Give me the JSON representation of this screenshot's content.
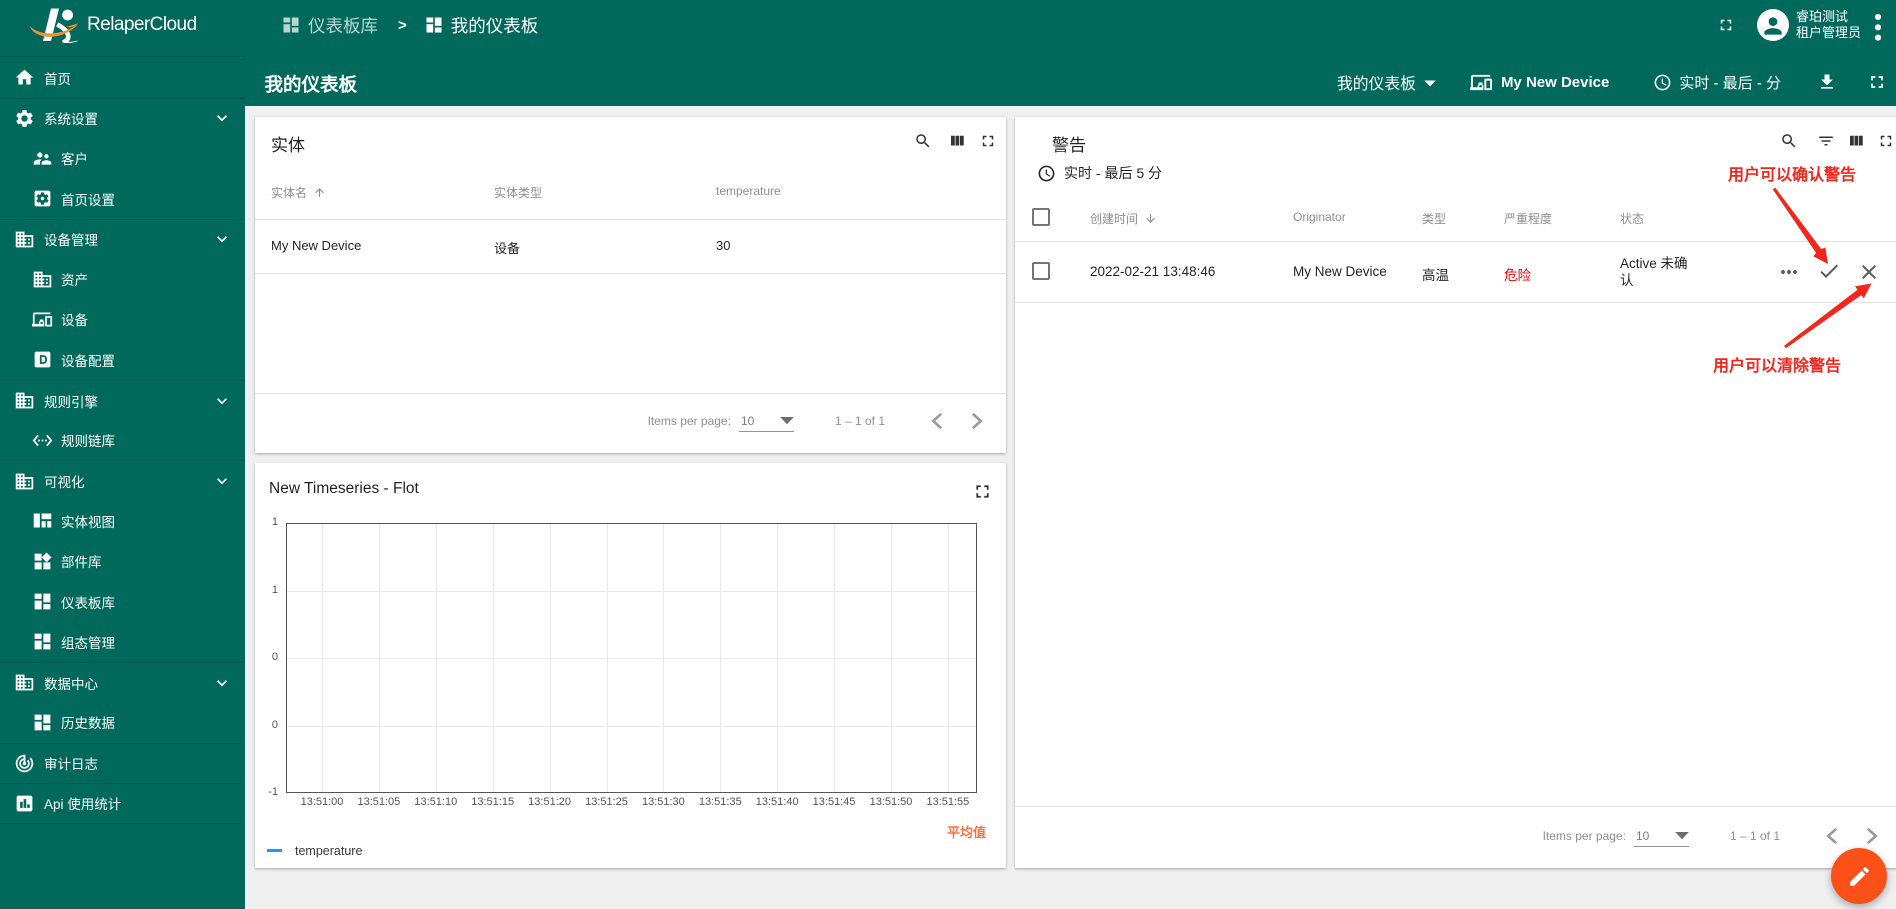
{
  "app": {
    "name": "RelaperCloud"
  },
  "colors": {
    "primary": "#00695c",
    "background": "#efefef",
    "danger_red": "#f00000",
    "annotation_red": "#f3261b",
    "series_blue": "#2196f3",
    "average_label_orange": "#ff7043",
    "fab_orange": "#fb5118",
    "logo_orange": "#ef9434"
  },
  "sidebar": {
    "items": [
      {
        "label": "首页",
        "icon": "home",
        "indent": false,
        "chevron": false,
        "divider": false
      },
      {
        "label": "系统设置",
        "icon": "settings",
        "indent": false,
        "chevron": true,
        "divider": true
      },
      {
        "label": "客户",
        "icon": "supervisor-account",
        "indent": true,
        "chevron": false,
        "divider": false
      },
      {
        "label": "首页设置",
        "icon": "settings-applications",
        "indent": true,
        "chevron": false,
        "divider": false
      },
      {
        "label": "设备管理",
        "icon": "domain",
        "indent": false,
        "chevron": true,
        "divider": true
      },
      {
        "label": "资产",
        "icon": "domain",
        "indent": true,
        "chevron": false,
        "divider": false
      },
      {
        "label": "设备",
        "icon": "devices-other",
        "indent": true,
        "chevron": false,
        "divider": false
      },
      {
        "label": "设备配置",
        "icon": "alpha-d-box",
        "indent": true,
        "chevron": false,
        "divider": false
      },
      {
        "label": "规则引擎",
        "icon": "domain",
        "indent": false,
        "chevron": true,
        "divider": true
      },
      {
        "label": "规则链库",
        "icon": "settings-ethernet",
        "indent": true,
        "chevron": false,
        "divider": false
      },
      {
        "label": "可视化",
        "icon": "domain",
        "indent": false,
        "chevron": true,
        "divider": true
      },
      {
        "label": "实体视图",
        "icon": "view-quilt",
        "indent": true,
        "chevron": false,
        "divider": false
      },
      {
        "label": "部件库",
        "icon": "widgets",
        "indent": true,
        "chevron": false,
        "divider": false
      },
      {
        "label": "仪表板库",
        "icon": "dashboard",
        "indent": true,
        "chevron": false,
        "divider": false
      },
      {
        "label": "组态管理",
        "icon": "dashboard",
        "indent": true,
        "chevron": false,
        "divider": false
      },
      {
        "label": "数据中心",
        "icon": "domain",
        "indent": false,
        "chevron": true,
        "divider": true
      },
      {
        "label": "历史数据",
        "icon": "dashboard",
        "indent": true,
        "chevron": false,
        "divider": false
      },
      {
        "label": "审计日志",
        "icon": "track-changes",
        "indent": false,
        "chevron": false,
        "divider": true
      },
      {
        "label": "Api 使用统计",
        "icon": "insert-chart",
        "indent": false,
        "chevron": false,
        "divider": true
      }
    ]
  },
  "topbar": {
    "breadcrumbs": [
      {
        "label": "仪表板库",
        "icon": "dashboard"
      },
      {
        "label": "我的仪表板",
        "icon": "dashboard"
      }
    ],
    "separator": ">",
    "user": {
      "name": "睿珀测试",
      "role": "租户管理员"
    }
  },
  "toolbar": {
    "title": "我的仪表板",
    "state_select": "我的仪表板",
    "device_label": "My New Device",
    "time_label": "实时 - 最后 - 分"
  },
  "entities_card": {
    "title": "实体",
    "columns": [
      "实体名",
      "实体类型",
      "temperature"
    ],
    "rows": [
      [
        "My New Device",
        "设备",
        "30"
      ]
    ],
    "pagination": {
      "items_per_page_label": "Items per page:",
      "page_size": "10",
      "range": "1 – 1 of 1"
    }
  },
  "chart_card": {
    "title": "New Timeseries - Flot",
    "legend": "temperature",
    "aggregation_label": "平均值"
  },
  "chart_data": {
    "type": "line",
    "title": "New Timeseries - Flot",
    "series": [
      {
        "name": "temperature",
        "color": "#2196f3",
        "values": []
      }
    ],
    "x_tick_labels": [
      "13:51:00",
      "13:51:05",
      "13:51:10",
      "13:51:15",
      "13:51:20",
      "13:51:25",
      "13:51:30",
      "13:51:35",
      "13:51:40",
      "13:51:45",
      "13:51:50",
      "13:51:55"
    ],
    "y_tick_labels": [
      "1",
      "1",
      "0",
      "0",
      "-1"
    ],
    "ylim": [
      -1,
      1
    ],
    "grid": true,
    "legend_position": "bottom-left"
  },
  "fab": {
    "icon": "edit-pencil"
  },
  "alarms_card": {
    "title": "警告",
    "time_label": "实时 - 最后 5 分",
    "columns": [
      "创建时间",
      "Originator",
      "类型",
      "严重程度",
      "状态"
    ],
    "row": {
      "created_time": "2022-02-21 13:48:46",
      "originator": "My New Device",
      "type": "高温",
      "severity": "危险",
      "status": "Active 未确认"
    },
    "annotations": {
      "ack": "用户可以确认警告",
      "clear": "用户可以清除警告"
    },
    "pagination": {
      "items_per_page_label": "Items per page:",
      "page_size": "10",
      "range": "1 – 1 of 1"
    }
  }
}
